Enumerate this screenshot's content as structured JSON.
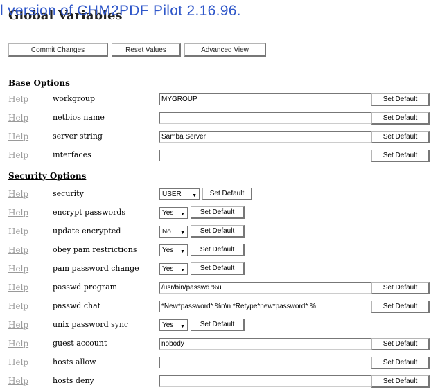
{
  "watermark": "l version of CHM2PDF Pilot 2.16.96.",
  "page_title": "Global Variables",
  "toolbar": {
    "commit_label": "Commit Changes",
    "reset_label": "Reset Values",
    "advanced_label": "Advanced View"
  },
  "help_label": "Help",
  "set_default_label": "Set Default",
  "sections": {
    "base": "Base Options",
    "security": "Security Options"
  },
  "base_rows": [
    {
      "label": "workgroup",
      "value": "MYGROUP"
    },
    {
      "label": "netbios name",
      "value": ""
    },
    {
      "label": "server string",
      "value": "Samba Server"
    },
    {
      "label": "interfaces",
      "value": ""
    }
  ],
  "security_rows": [
    {
      "label": "security",
      "value": "USER"
    },
    {
      "label": "encrypt passwords",
      "value": "Yes"
    },
    {
      "label": "update encrypted",
      "value": "No"
    },
    {
      "label": "obey pam restrictions",
      "value": "Yes"
    },
    {
      "label": "pam password change",
      "value": "Yes"
    },
    {
      "label": "passwd program",
      "value": "/usr/bin/passwd %u"
    },
    {
      "label": "passwd chat",
      "value": "*New*password* %n\\n *Retype*new*password* %"
    },
    {
      "label": "unix password sync",
      "value": "Yes"
    },
    {
      "label": "guest account",
      "value": "nobody"
    },
    {
      "label": "hosts allow",
      "value": ""
    },
    {
      "label": "hosts deny",
      "value": ""
    }
  ],
  "colors": {
    "watermark": "#2e56c9",
    "help_link": "#9a9a9a"
  }
}
